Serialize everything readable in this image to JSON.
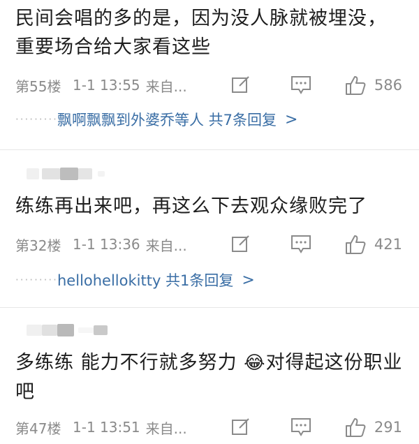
{
  "comments": [
    {
      "text": "民间会唱的多的是，因为没人脉就被埋没，重要场合给大家看这些",
      "floor": "第55楼",
      "date": "1-1 13:55",
      "source": "来自...",
      "likes": "586",
      "replies": {
        "text": "飘啊飘飘到外婆乔等人 共7条回复",
        "chevron": ">"
      }
    },
    {
      "text": "练练再出来吧，再这么下去观众缘败完了",
      "floor": "第32楼",
      "date": "1-1 13:36",
      "source": "来自...",
      "likes": "421",
      "replies": {
        "text": "hellohellokitty 共1条回复",
        "chevron": ">"
      }
    },
    {
      "text": "多练练 能力不行就多努力 对得起这份职业吧",
      "text_part1": "多练练 能力不行就多努力 ",
      "text_part2": "对得起这份职业吧",
      "emoji": "😂",
      "floor": "第47楼",
      "date": "1-1 13:51",
      "source": "来自...",
      "likes": "291"
    }
  ],
  "dots": "·········",
  "icons": {
    "edit": "edit-icon",
    "reply": "comment-icon",
    "like": "thumbs-up-icon",
    "emoji": "laugh-cry-emoji"
  },
  "colors": {
    "reply_link": "#3a6ea5",
    "meta_text": "#8a8a8a",
    "divider": "#e6e6e6"
  }
}
